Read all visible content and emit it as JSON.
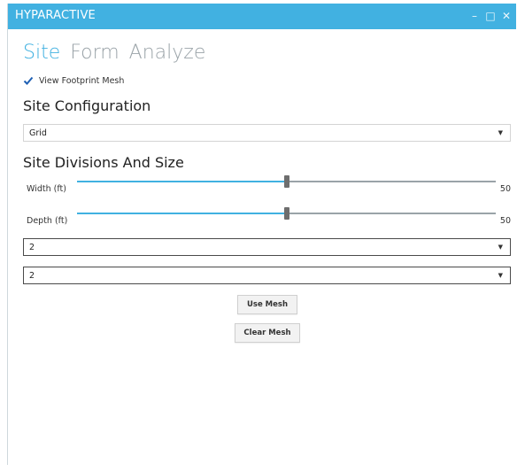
{
  "window": {
    "title": "HYPARACTIVE"
  },
  "nav": {
    "tabs": [
      "Site",
      "Form",
      "Analyze"
    ],
    "active_tab": "Site"
  },
  "checkbox": {
    "label": "View Footprint Mesh",
    "checked": true
  },
  "site_configuration": {
    "heading": "Site Configuration",
    "selected": "Grid"
  },
  "site_divisions": {
    "heading": "Site Divisions And Size",
    "width": {
      "label": "Width (ft)",
      "value": "50",
      "fraction": 0.5
    },
    "depth": {
      "label": "Depth (ft)",
      "value": "50",
      "fraction": 0.5
    },
    "dropdown1": {
      "selected": "2"
    },
    "dropdown2": {
      "selected": "2"
    }
  },
  "buttons": {
    "use_mesh": "Use Mesh",
    "clear_mesh": "Clear Mesh"
  },
  "colors": {
    "accent": "#41b1e1",
    "inactive_text": "#9aa3a8"
  },
  "icons": {
    "minimize": "minimize-icon",
    "maximize": "maximize-icon",
    "close": "close-icon",
    "check": "check-icon",
    "caret": "caret-down-icon"
  }
}
